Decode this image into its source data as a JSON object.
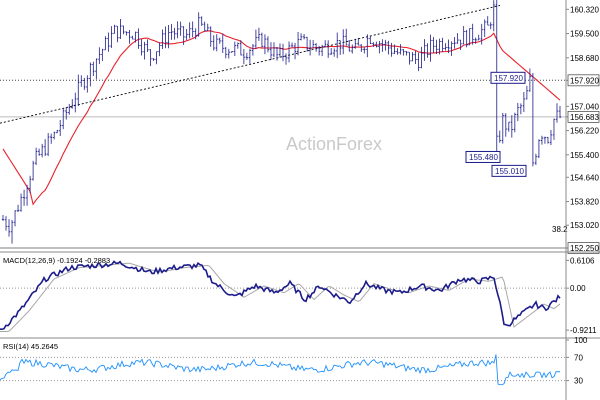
{
  "chart_data": {
    "type": "candlestick",
    "watermark": "ActionForex",
    "price_panel": {
      "ylim": [
        152.25,
        160.5
      ],
      "y_ticks": [
        "160.320",
        "159.500",
        "158.680",
        "157.920",
        "157.040",
        "156.683",
        "156.220",
        "155.400",
        "154.640",
        "153.820",
        "153.020",
        "152.250"
      ],
      "last_price": "156.683",
      "level_lines": [
        {
          "value": 157.92,
          "label": "157.920",
          "style": "dotted"
        },
        {
          "value": 156.683,
          "label": "156.683",
          "style": "solid-light"
        },
        {
          "value": 152.25,
          "label": "152.250",
          "style": "solid"
        }
      ],
      "fib_label": "38.2",
      "callouts": [
        {
          "label": "157.920",
          "value": 157.92
        },
        {
          "label": "155.480",
          "value": 155.48
        },
        {
          "label": "155.010",
          "value": 155.01
        }
      ],
      "ma_color": "#e8202a",
      "trendline_color": "#000000",
      "candle_color": "#1c1c8c"
    },
    "macd_panel": {
      "title": "MACD(12,26,9) -0.1924 -0.2883",
      "y_ticks": [
        "0.6106",
        "0.00",
        "-0.9211"
      ],
      "ylim": [
        -1.05,
        0.75
      ],
      "macd_color": "#1c1c8c",
      "signal_color": "#a8a8a8"
    },
    "rsi_panel": {
      "title": "RSI(14) 45.2645",
      "y_ticks": [
        "100",
        "70",
        "30"
      ],
      "ylim": [
        0,
        100
      ],
      "rsi_color": "#1e90ff"
    }
  }
}
